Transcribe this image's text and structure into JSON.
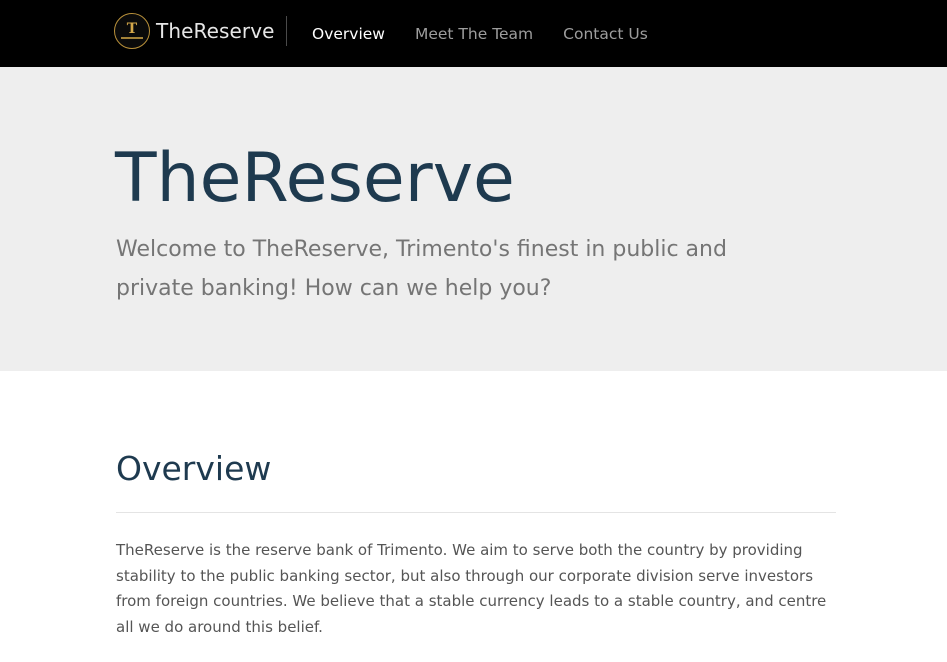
{
  "navbar": {
    "brand": "TheReserve",
    "logo_icon": "reserve-logo-icon",
    "links": [
      {
        "label": "Overview",
        "active": true
      },
      {
        "label": "Meet The Team",
        "active": false
      },
      {
        "label": "Contact Us",
        "active": false
      }
    ]
  },
  "hero": {
    "title": "TheReserve",
    "subtitle": "Welcome to TheReserve, Trimento's finest in public and private banking! How can we help you?"
  },
  "overview": {
    "heading": "Overview",
    "body": "TheReserve is the reserve bank of Trimento. We aim to serve both the country by providing stability to the public banking sector, but also through our corporate division serve investors from foreign countries. We believe that a stable currency leads to a stable country, and centre all we do around this belief."
  },
  "colors": {
    "navbar_bg": "#000000",
    "hero_bg": "#eeeeee",
    "heading_color": "#1e3a4f",
    "logo_gold": "#b8903a"
  }
}
